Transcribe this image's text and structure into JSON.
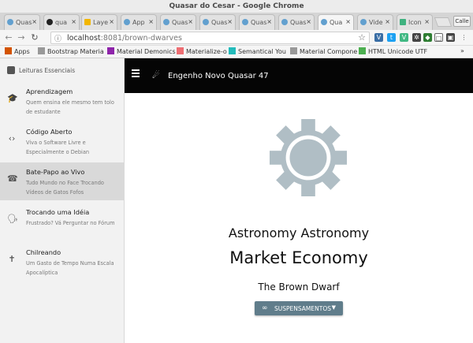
{
  "window": {
    "title": "Quasar do Cesar - Google Chrome"
  },
  "tabs": [
    {
      "label": "Quas",
      "icon": "quasar-icon"
    },
    {
      "label": "qua",
      "icon": "github-icon"
    },
    {
      "label": "Laye",
      "icon": "layer-icon"
    },
    {
      "label": "App",
      "icon": "quasar-icon"
    },
    {
      "label": "Quas",
      "icon": "quasar-icon"
    },
    {
      "label": "Quas",
      "icon": "quasar-icon"
    },
    {
      "label": "Quas",
      "icon": "quasar-icon"
    },
    {
      "label": "Quas",
      "icon": "quasar-icon"
    },
    {
      "label": "Qua",
      "icon": "quasar-icon",
      "active": true
    },
    {
      "label": "Vide",
      "icon": "quasar-icon"
    },
    {
      "label": "Icon",
      "icon": "vue-icon"
    }
  ],
  "browser": {
    "url_host": "localhost",
    "url_path": ":8081/brown-dwarves",
    "caller_label": "Calle"
  },
  "bookmarks": [
    {
      "label": "Apps",
      "icon": "apps-grid-icon"
    },
    {
      "label": "Bootstrap Materia",
      "icon": "page-icon"
    },
    {
      "label": "Material Demonics",
      "icon": "purple-square-icon"
    },
    {
      "label": "Materialize-o",
      "icon": "m-icon"
    },
    {
      "label": "Semantical You",
      "icon": "s-icon"
    },
    {
      "label": "Material Compone",
      "icon": "page-icon"
    },
    {
      "label": "HTML Unicode UTF",
      "icon": "green-icon"
    }
  ],
  "drawer": {
    "header": "Leituras Essenciais",
    "items": [
      {
        "title": "Aprendizagem",
        "subtitle": "Quem ensina ele mesmo tem tolo de estudante",
        "icon": "school-icon",
        "glyph": "🎓"
      },
      {
        "title": "Código Aberto",
        "subtitle": "Viva o Software Livre e Especialmente o Debian",
        "icon": "code-icon",
        "glyph": "‹›"
      },
      {
        "title": "Bate-Papo ao Vivo",
        "subtitle": "Tudo Mundo no Face Trocando Vídeos de Gatos Fofos",
        "icon": "call-end-icon",
        "glyph": "☎",
        "active": true
      },
      {
        "title": "Trocando uma Idéia",
        "subtitle": "Frustrado? Vá Perguntar no Fórum",
        "icon": "record-voice-icon",
        "glyph": "🗣"
      },
      {
        "title": "Chilreando",
        "subtitle": "Um Gasto de Tempo Numa Escala Apocalíptica",
        "icon": "accessibility-icon",
        "glyph": "✝"
      }
    ]
  },
  "toolbar": {
    "title": "Engenho Novo Quasar 47"
  },
  "main": {
    "line1": "Astronomy Astronomy",
    "line2": "Market Economy",
    "line3": "The Brown Dwarf",
    "button_label": "SUSPENSAMENTOS"
  },
  "colors": {
    "gear": "#b0bec5",
    "button": "#607d8b",
    "toolbar": "#050505"
  }
}
